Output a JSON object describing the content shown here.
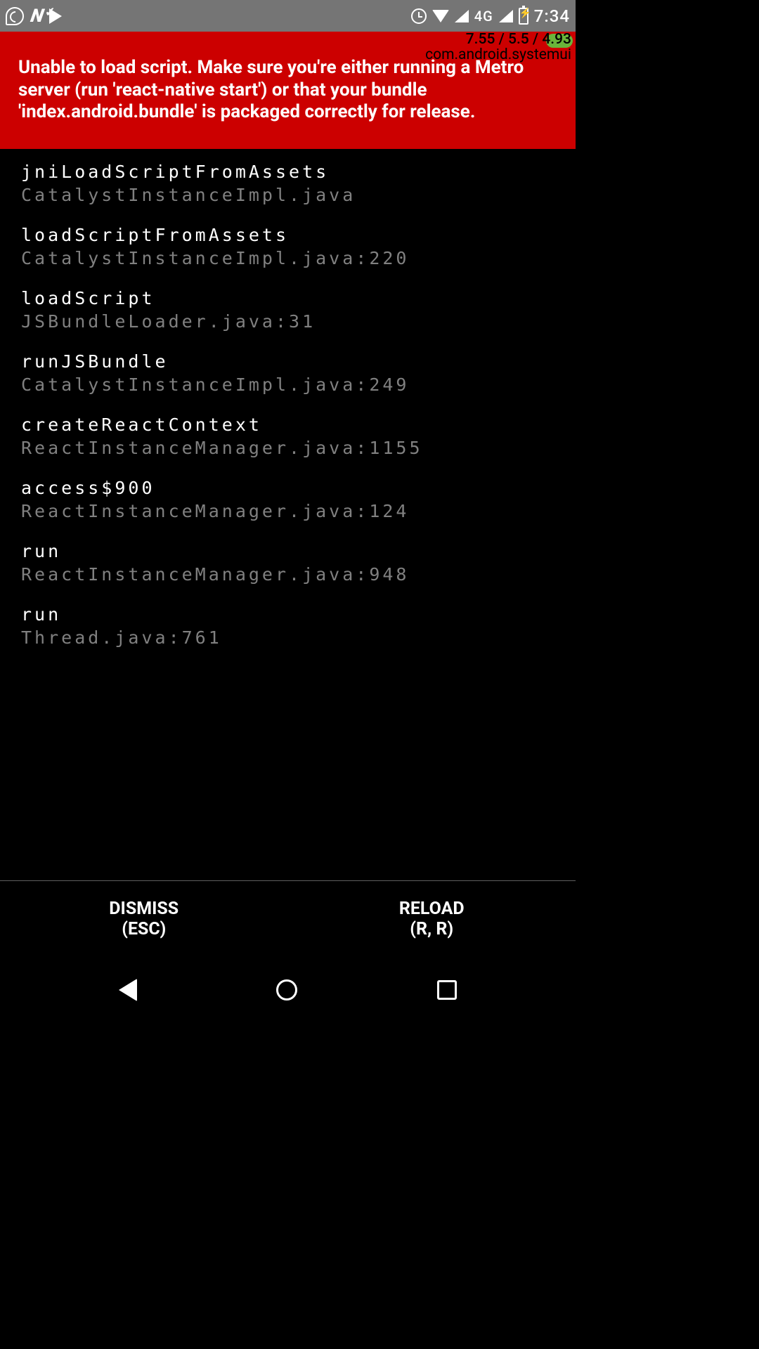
{
  "status": {
    "notif_text": "N",
    "network_label": "4G",
    "clock": "7:34"
  },
  "debug": {
    "line1": "7.55 / 5.5 / 4.93",
    "line2": "com.android.systemui"
  },
  "error": {
    "message": "Unable to load script. Make sure you're either running a Metro server (run 'react-native start') or that your bundle 'index.android.bundle' is packaged correctly for release."
  },
  "stack": [
    {
      "method": "jniLoadScriptFromAssets",
      "loc": "CatalystInstanceImpl.java"
    },
    {
      "method": "loadScriptFromAssets",
      "loc": "CatalystInstanceImpl.java:220"
    },
    {
      "method": "loadScript",
      "loc": "JSBundleLoader.java:31"
    },
    {
      "method": "runJSBundle",
      "loc": "CatalystInstanceImpl.java:249"
    },
    {
      "method": "createReactContext",
      "loc": "ReactInstanceManager.java:1155"
    },
    {
      "method": "access$900",
      "loc": "ReactInstanceManager.java:124"
    },
    {
      "method": "run",
      "loc": "ReactInstanceManager.java:948"
    },
    {
      "method": "run",
      "loc": "Thread.java:761"
    }
  ],
  "buttons": {
    "dismiss_label": "DISMISS",
    "dismiss_hint": "(ESC)",
    "reload_label": "RELOAD",
    "reload_hint": "(R, R)"
  }
}
